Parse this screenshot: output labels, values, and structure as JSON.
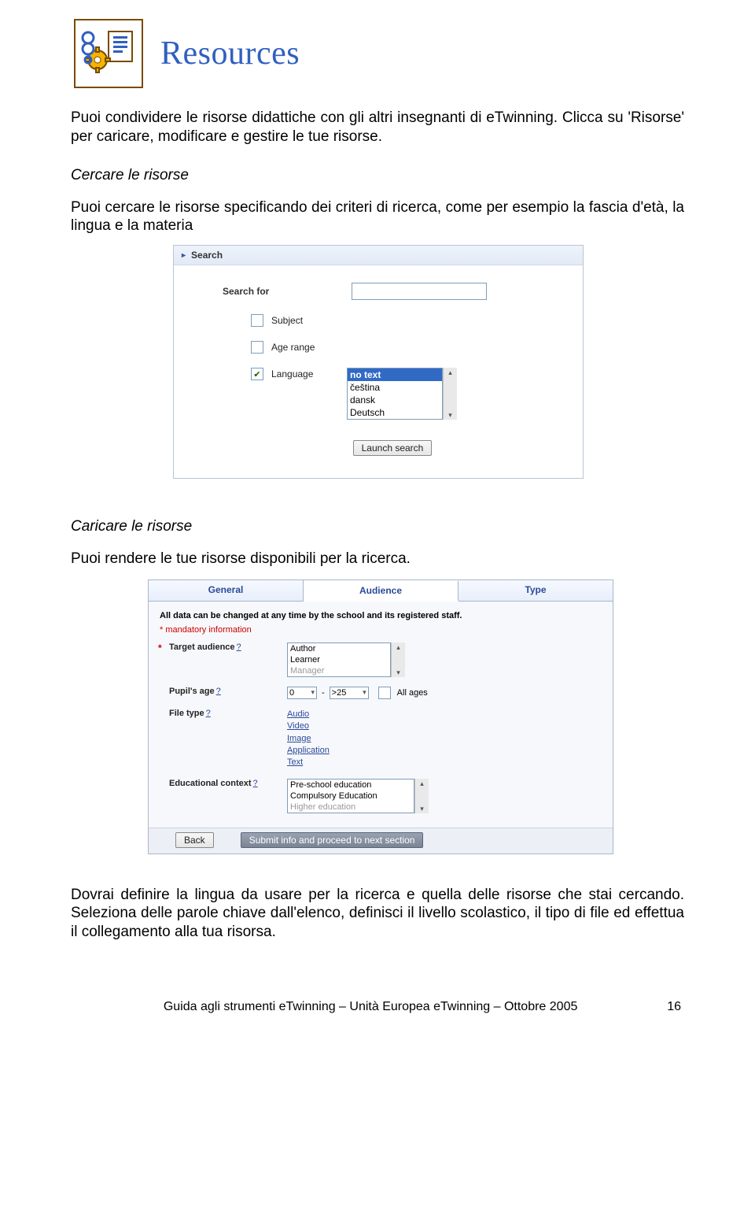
{
  "header": {
    "title": "Resources"
  },
  "intro": "Puoi condividere le risorse didattiche con gli altri insegnanti di eTwinning. Clicca su 'Risorse' per caricare, modificare e gestire le tue risorse.",
  "section1": {
    "heading": "Cercare le risorse",
    "text": "Puoi cercare le risorse specificando dei criteri di ricerca, come per esempio la fascia d'età, la lingua e la materia"
  },
  "search_panel": {
    "title": "Search",
    "search_for": "Search for",
    "subject": "Subject",
    "age_range": "Age range",
    "language": "Language",
    "lang_options": [
      "no text",
      "čeština",
      "dansk",
      "Deutsch"
    ],
    "launch": "Launch search"
  },
  "section2": {
    "heading": "Caricare le risorse",
    "text": "Puoi rendere le tue risorse disponibili per la ricerca."
  },
  "form_panel": {
    "tabs": [
      "General",
      "Audience",
      "Type"
    ],
    "note": "All data can be changed at any time by the school and its registered staff.",
    "mandatory": "* mandatory information",
    "rows": {
      "target": {
        "label": "Target audience",
        "options": [
          "Author",
          "Learner",
          "Manager"
        ]
      },
      "age": {
        "label": "Pupil's age",
        "from": "0",
        "to": ">25",
        "all_ages": "All ages"
      },
      "filetype": {
        "label": "File type",
        "links": [
          "Audio",
          "Video",
          "Image",
          "Application",
          "Text"
        ]
      },
      "edu": {
        "label": "Educational context",
        "options": [
          "Pre-school education",
          "Compulsory Education",
          "Higher education"
        ]
      }
    },
    "back": "Back",
    "submit": "Submit info and proceed to next section"
  },
  "outro": "Dovrai definire la lingua da usare per la ricerca e quella delle risorse che stai cercando. Seleziona delle parole chiave dall'elenco, definisci il livello scolastico, il tipo di file ed effettua il collegamento alla tua risorsa.",
  "footer": {
    "text": "Guida agli strumenti eTwinning – Unità Europea eTwinning – Ottobre 2005",
    "page": "16"
  }
}
